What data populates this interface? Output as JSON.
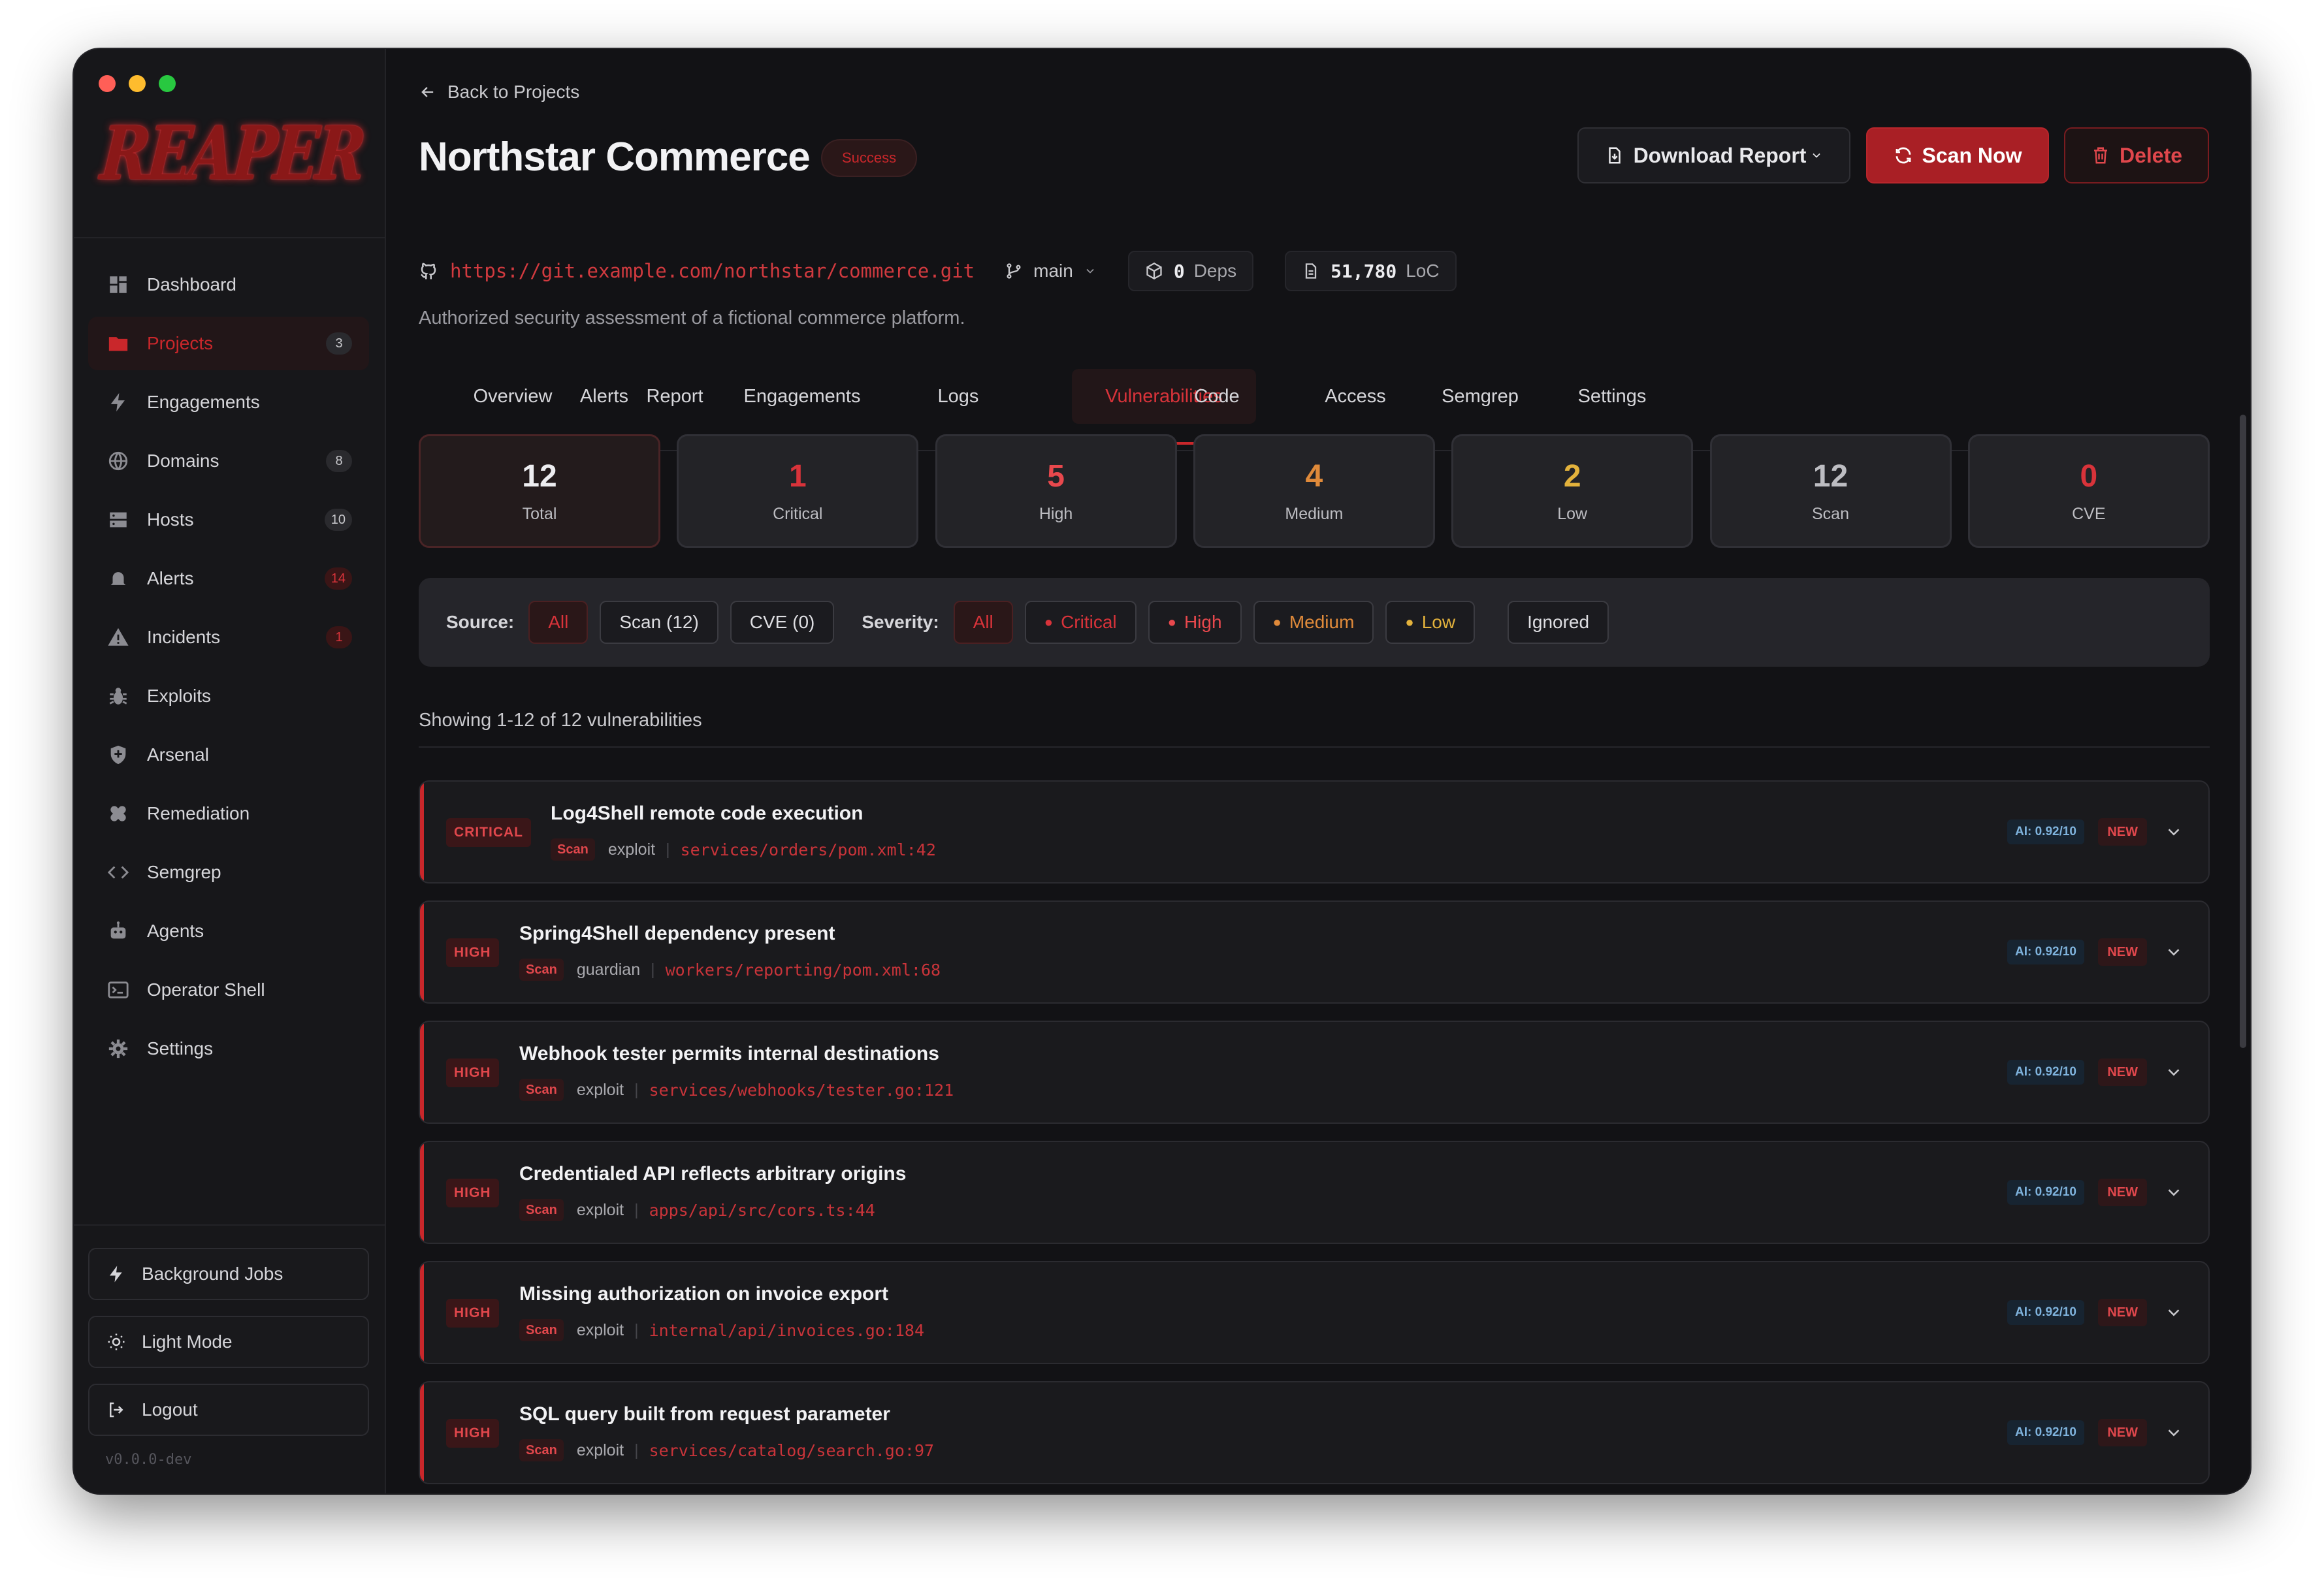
{
  "window": {
    "traffic_lights": [
      "#ff5f57",
      "#febc2e",
      "#28c840"
    ]
  },
  "sidebar": {
    "logo": "REAPER",
    "items": [
      {
        "label": "Dashboard",
        "icon": "dashboard-icon",
        "badge": ""
      },
      {
        "label": "Projects",
        "icon": "folder-icon",
        "badge": "3",
        "active": true
      },
      {
        "label": "Engagements",
        "icon": "bolt-icon",
        "badge": ""
      },
      {
        "label": "Domains",
        "icon": "globe-icon",
        "badge": "8"
      },
      {
        "label": "Hosts",
        "icon": "server-icon",
        "badge": "10"
      },
      {
        "label": "Alerts",
        "icon": "bell-icon",
        "badge": "14"
      },
      {
        "label": "Incidents",
        "icon": "warning-icon",
        "badge": "1"
      },
      {
        "label": "Exploits",
        "icon": "bug-icon",
        "badge": ""
      },
      {
        "label": "Arsenal",
        "icon": "shield-icon",
        "badge": ""
      },
      {
        "label": "Remediation",
        "icon": "bandage-icon",
        "badge": ""
      },
      {
        "label": "Semgrep",
        "icon": "code-icon",
        "badge": ""
      },
      {
        "label": "Agents",
        "icon": "robot-icon",
        "badge": ""
      },
      {
        "label": "Operator Shell",
        "icon": "terminal-icon",
        "badge": ""
      },
      {
        "label": "Settings",
        "icon": "gear-icon",
        "badge": ""
      }
    ],
    "background_jobs": "Background Jobs",
    "light_mode": "Light Mode",
    "logout": "Logout",
    "version": "v0.0.0-dev"
  },
  "header": {
    "back": "Back to Projects",
    "title": "Northstar Commerce",
    "status": "Success",
    "download_report": "Download Report",
    "scan_now": "Scan Now",
    "delete": "Delete",
    "repo_url": "https://git.example.com/northstar/commerce.git",
    "branch": "main",
    "deps_count": "0",
    "deps_label": "Deps",
    "loc_count": "51,780",
    "loc_label": "LoC",
    "description": "Authorized security assessment of a fictional commerce platform."
  },
  "tabs": [
    "Overview",
    "Alerts",
    "Report",
    "Engagements",
    "Logs",
    "Vulnerabilities",
    "Code",
    "Access",
    "Semgrep",
    "Settings"
  ],
  "active_tab": "Vulnerabilities",
  "stats": [
    {
      "value": "12",
      "label": "Total",
      "color": "#ededf0"
    },
    {
      "value": "1",
      "label": "Critical",
      "color": "#d8333a"
    },
    {
      "value": "5",
      "label": "High",
      "color": "#e8484d"
    },
    {
      "value": "4",
      "label": "Medium",
      "color": "#e08a3a"
    },
    {
      "value": "2",
      "label": "Low",
      "color": "#e3b23c"
    },
    {
      "value": "12",
      "label": "Scan",
      "color": "#bdbdc2"
    },
    {
      "value": "0",
      "label": "CVE",
      "color": "#d8333a"
    }
  ],
  "filters": {
    "source_label": "Source:",
    "source_options": [
      "All",
      "Scan (12)",
      "CVE (0)"
    ],
    "severity_label": "Severity:",
    "severity_options": [
      {
        "label": "All",
        "color": ""
      },
      {
        "label": "Critical",
        "color": "#d8333a"
      },
      {
        "label": "High",
        "color": "#e8484d"
      },
      {
        "label": "Medium",
        "color": "#e08a3a"
      },
      {
        "label": "Low",
        "color": "#e3b23c"
      }
    ],
    "ignored": "Ignored"
  },
  "showing": "Showing 1-12 of 12 vulnerabilities",
  "vulnerabilities": [
    {
      "severity": "CRITICAL",
      "title": "Log4Shell remote code execution",
      "source": "Scan",
      "type": "exploit",
      "path": "services/orders/pom.xml:42",
      "ai": "AI: 0.92/10",
      "status": "NEW"
    },
    {
      "severity": "HIGH",
      "title": "Spring4Shell dependency present",
      "source": "Scan",
      "type": "guardian",
      "path": "workers/reporting/pom.xml:68",
      "ai": "AI: 0.92/10",
      "status": "NEW"
    },
    {
      "severity": "HIGH",
      "title": "Webhook tester permits internal destinations",
      "source": "Scan",
      "type": "exploit",
      "path": "services/webhooks/tester.go:121",
      "ai": "AI: 0.92/10",
      "status": "NEW"
    },
    {
      "severity": "HIGH",
      "title": "Credentialed API reflects arbitrary origins",
      "source": "Scan",
      "type": "exploit",
      "path": "apps/api/src/cors.ts:44",
      "ai": "AI: 0.92/10",
      "status": "NEW"
    },
    {
      "severity": "HIGH",
      "title": "Missing authorization on invoice export",
      "source": "Scan",
      "type": "exploit",
      "path": "internal/api/invoices.go:184",
      "ai": "AI: 0.92/10",
      "status": "NEW"
    },
    {
      "severity": "HIGH",
      "title": "SQL query built from request parameter",
      "source": "Scan",
      "type": "exploit",
      "path": "services/catalog/search.go:97",
      "ai": "AI: 0.92/10",
      "status": "NEW"
    }
  ]
}
